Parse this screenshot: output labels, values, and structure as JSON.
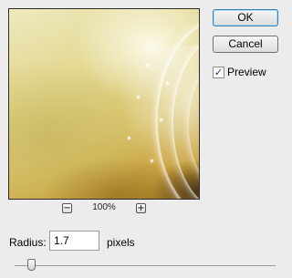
{
  "preview": {
    "zoom_out_label": "−",
    "zoom_level": "100%",
    "zoom_in_label": "+"
  },
  "buttons": {
    "ok_label": "OK",
    "cancel_label": "Cancel"
  },
  "preview_toggle": {
    "label": "Preview",
    "checked": true,
    "check_mark": "✓"
  },
  "radius": {
    "label": "Radius:",
    "value": "1.7",
    "units": "pixels"
  },
  "slider": {
    "icon": "slider-thumb"
  }
}
